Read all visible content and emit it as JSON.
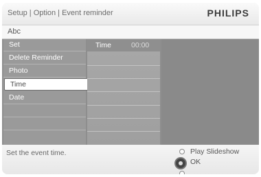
{
  "header": {
    "breadcrumb": "Setup | Option | Event reminder",
    "brand": "PHILIPS"
  },
  "title": "Abc",
  "menu": {
    "items": [
      {
        "label": "Set"
      },
      {
        "label": "Delete Reminder"
      },
      {
        "label": "Photo"
      },
      {
        "label": "Time"
      },
      {
        "label": "Date"
      }
    ],
    "selected": "Time"
  },
  "submenu": {
    "label": "Time",
    "value": "00:00"
  },
  "footer": {
    "hint": "Set the event time.",
    "nav": {
      "up_label": "Play Slideshow",
      "ok_label": "OK"
    }
  }
}
